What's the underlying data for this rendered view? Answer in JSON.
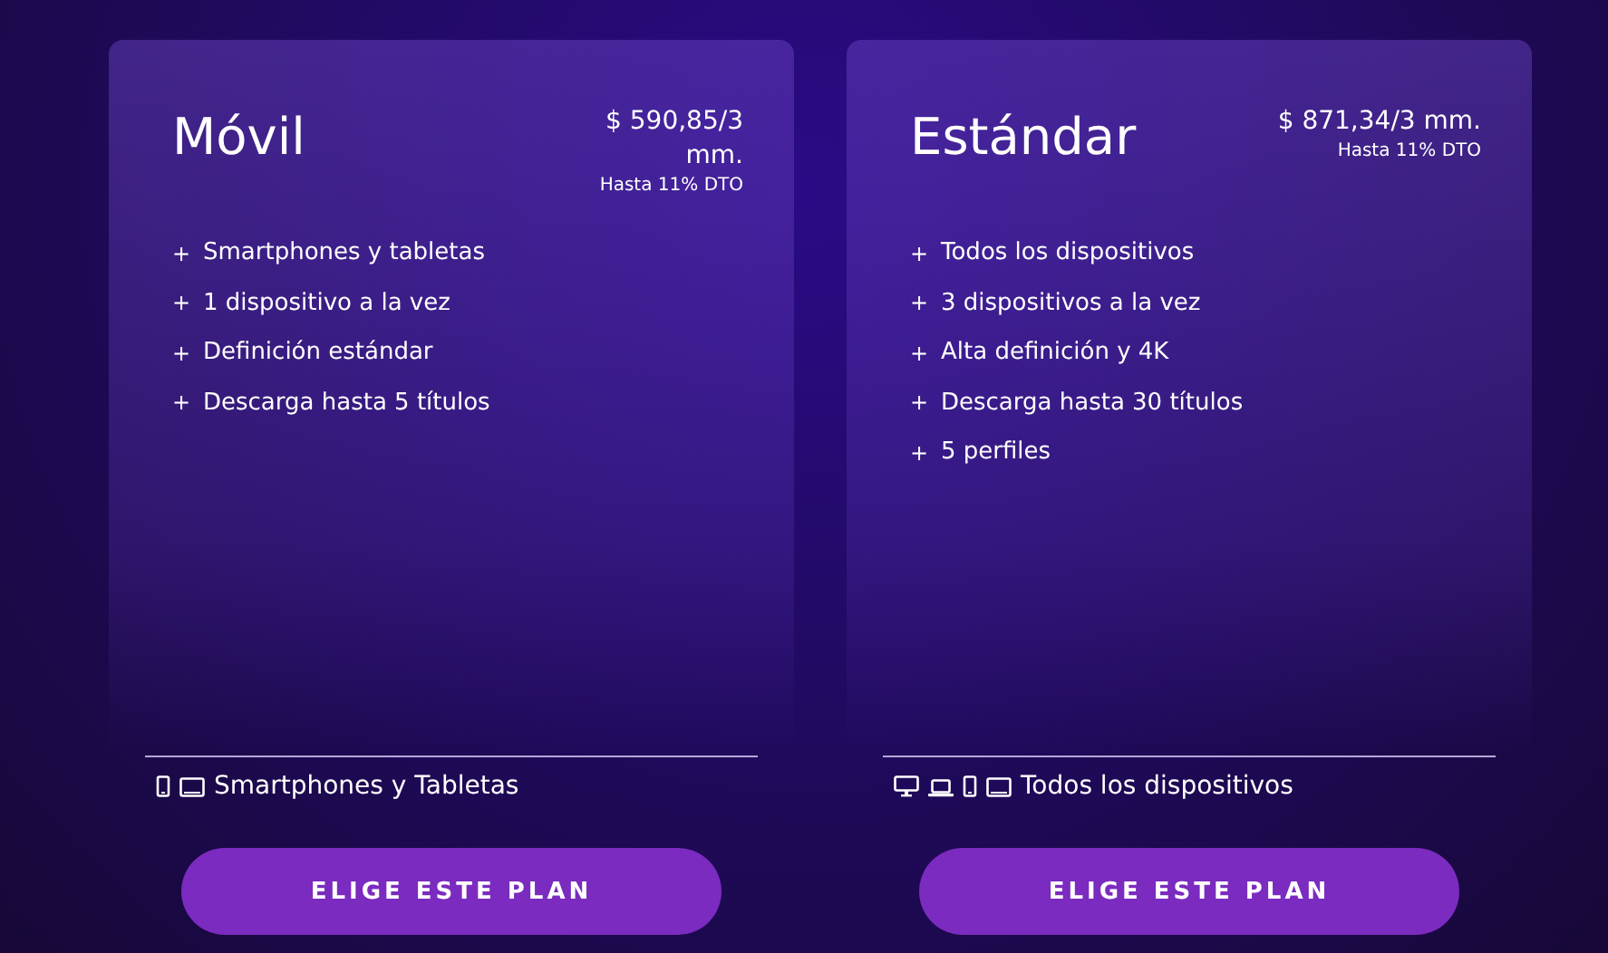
{
  "plans": [
    {
      "name": "Móvil",
      "price_lines": [
        "$ 590,85/3",
        "mm."
      ],
      "discount": "Hasta 11% DTO",
      "features": [
        {
          "bullet": "+",
          "text": "Smartphones y tabletas"
        },
        {
          "bullet": "+",
          "text": "1 dispositivo a la vez"
        },
        {
          "bullet": "+",
          "text": "Definición estándar"
        },
        {
          "bullet": "+",
          "text": "Descarga hasta 5 títulos"
        }
      ],
      "devices": [
        {
          "kind": "phone"
        },
        {
          "kind": "tablet"
        }
      ],
      "devices_label": "Smartphones y Tabletas",
      "button": "ELIGE ESTE PLAN"
    },
    {
      "name": "Estándar",
      "price_lines": [
        "$ 871,34/3 mm."
      ],
      "discount": "Hasta 11% DTO",
      "features": [
        {
          "bullet": "+",
          "text": "Todos los dispositivos"
        },
        {
          "bullet": "+",
          "text": "3 dispositivos a la vez"
        },
        {
          "bullet": "+",
          "text": "Alta definición y 4K"
        },
        {
          "bullet": "+",
          "text": "Descarga hasta 30 títulos"
        },
        {
          "bullet": "+",
          "text": "5 perfiles"
        }
      ],
      "devices": [
        {
          "kind": "desktop"
        },
        {
          "kind": "laptop"
        },
        {
          "kind": "phone"
        },
        {
          "kind": "tablet"
        }
      ],
      "devices_label": "Todos los dispositivos",
      "button": "ELIGE ESTE PLAN"
    }
  ]
}
